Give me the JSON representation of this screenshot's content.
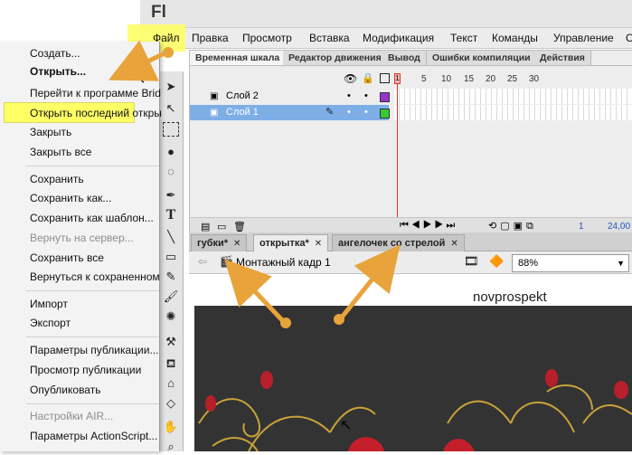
{
  "app": {
    "logo": "Fl"
  },
  "menubar": {
    "items": [
      "Файл",
      "Правка",
      "Просмотр",
      "Вставка",
      "Модификация",
      "Текст",
      "Команды",
      "Управление",
      "От"
    ]
  },
  "file_menu": {
    "items": [
      {
        "label": "Создать...",
        "enabled": true
      },
      {
        "label": "Открыть...",
        "enabled": true,
        "highlighted": true
      },
      {
        "label": "Перейти к программе Brid",
        "enabled": true
      },
      {
        "label": "Открыть последний откры",
        "enabled": true
      },
      {
        "label": "Закрыть",
        "enabled": true
      },
      {
        "label": "Закрыть все",
        "enabled": true
      },
      {
        "label": "Сохранить",
        "enabled": true
      },
      {
        "label": "Сохранить как...",
        "enabled": true
      },
      {
        "label": "Сохранить как шаблон...",
        "enabled": true
      },
      {
        "label": "Вернуть на сервер...",
        "enabled": false
      },
      {
        "label": "Сохранить все",
        "enabled": true
      },
      {
        "label": "Вернуться к сохраненном",
        "enabled": true
      },
      {
        "label": "Импорт",
        "enabled": true
      },
      {
        "label": "Экспорт",
        "enabled": true
      },
      {
        "label": "Параметры публикации...",
        "enabled": true
      },
      {
        "label": "Просмотр публикации",
        "enabled": true
      },
      {
        "label": "Опубликовать",
        "enabled": true
      },
      {
        "label": "Настройки AIR...",
        "enabled": false
      },
      {
        "label": "Параметры ActionScript...",
        "enabled": true
      }
    ]
  },
  "timeline": {
    "tabs": [
      "Временная шкала",
      "Редактор движения",
      "Вывод",
      "Ошибки компиляции",
      "Действия"
    ],
    "active_tab": "Временная шкала",
    "ruler": [
      "1",
      "5",
      "10",
      "15",
      "20",
      "25",
      "30"
    ],
    "layers": [
      {
        "name": "Слой 2",
        "color": "#9933cc",
        "selected": false
      },
      {
        "name": "Слой 1",
        "color": "#33cc33",
        "selected": true
      }
    ],
    "status": {
      "frame": "1",
      "fps": "24,00"
    }
  },
  "document": {
    "tabs": [
      {
        "label": "губки*",
        "active": false
      },
      {
        "label": "открытка*",
        "active": true
      },
      {
        "label": "ангелочек со стрелой",
        "active": false
      }
    ],
    "scene": "Монтажный кадр 1",
    "zoom": "88%",
    "watermark": "novprospekt"
  },
  "colors": {
    "highlight": "#ffff66",
    "arrow": "#e8a33a",
    "stage": "#333333",
    "selected_layer": "#7eaee6"
  }
}
